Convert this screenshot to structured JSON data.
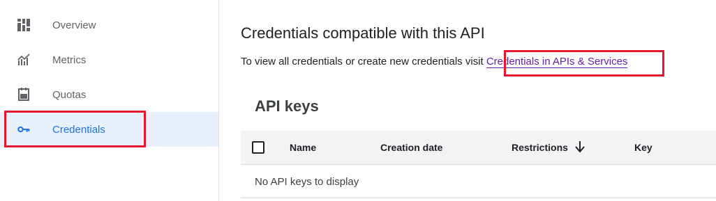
{
  "sidebar": {
    "items": [
      {
        "label": "Overview",
        "icon": "dashboard-icon",
        "active": false
      },
      {
        "label": "Metrics",
        "icon": "chart-icon",
        "active": false
      },
      {
        "label": "Quotas",
        "icon": "quota-icon",
        "active": false
      },
      {
        "label": "Credentials",
        "icon": "key-icon",
        "active": true
      }
    ]
  },
  "main": {
    "title": "Credentials compatible with this API",
    "info_text": "To view all credentials or create new credentials visit",
    "info_link": "Credentials in APIs & Services",
    "section_title": "API keys",
    "table": {
      "columns": [
        "Name",
        "Creation date",
        "Restrictions",
        "Key"
      ],
      "empty_message": "No API keys to display"
    }
  },
  "colors": {
    "active_blue": "#1a73e8",
    "link_purple": "#681da8",
    "highlight_red": "#e5162e",
    "active_bg": "#e8f0fe"
  }
}
